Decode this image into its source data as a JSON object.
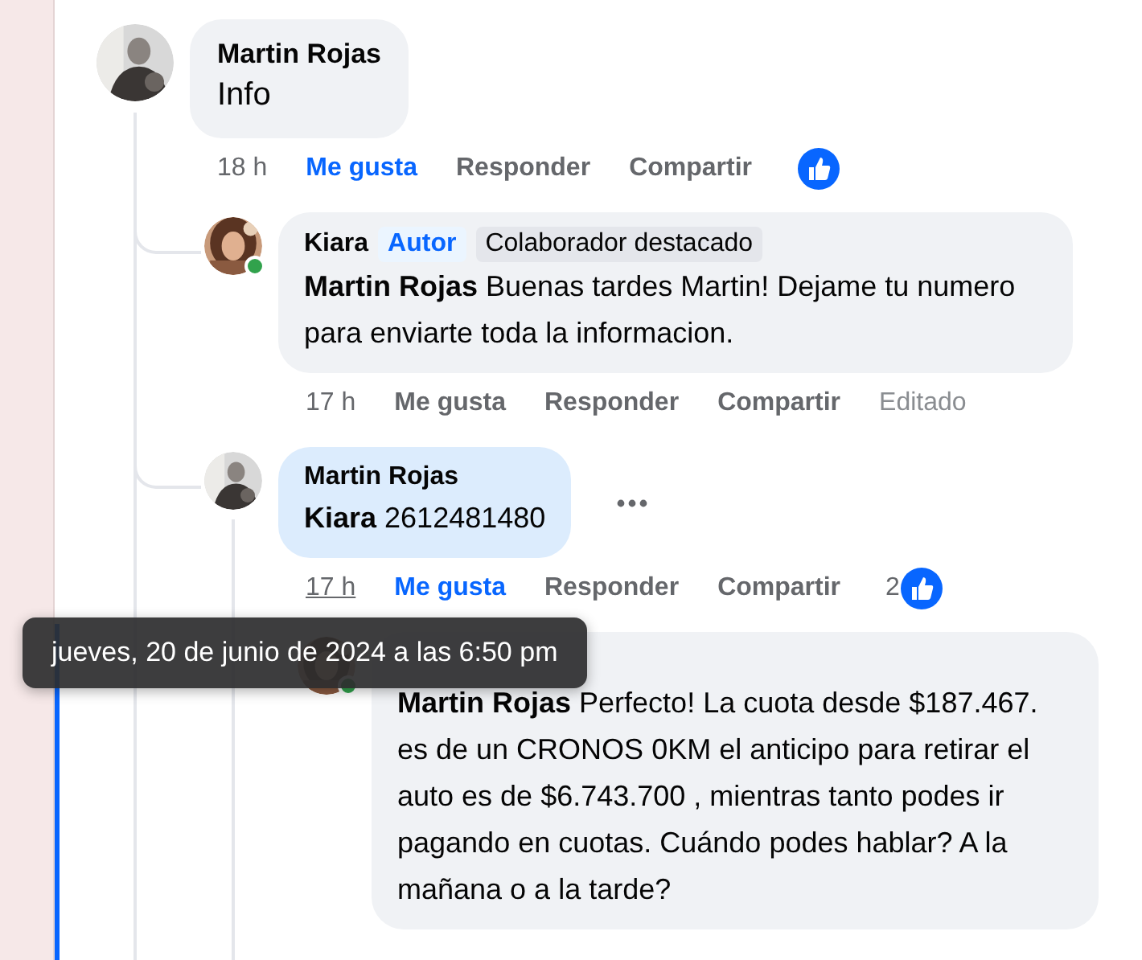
{
  "comments": [
    {
      "author": "Martin Rojas",
      "online": false,
      "text": "Info",
      "time": "18 h",
      "time_hovered": false,
      "like_label": "Me gusta",
      "liked": true,
      "reply_label": "Responder",
      "share_label": "Compartir",
      "reactions": true,
      "children": [
        {
          "author": "Kiara",
          "online": true,
          "badges": [
            {
              "kind": "author",
              "label": "Autor"
            },
            {
              "kind": "top-contributor",
              "label": "Colaborador destacado"
            }
          ],
          "text": "**Martin Rojas** Buenas tardes Martin! Dejame tu numero para enviarte toda la informacion.",
          "time": "17 h",
          "time_hovered": false,
          "like_label": "Me gusta",
          "liked": false,
          "reply_label": "Responder",
          "share_label": "Compartir",
          "edited_label": "Editado"
        },
        {
          "author": "Martin Rojas",
          "online": false,
          "highlighted": true,
          "text": "**Kiara** 2612481480",
          "time": "17 h",
          "time_hovered": true,
          "like_label": "Me gusta",
          "liked": true,
          "reply_label": "Responder",
          "share_label": "Compartir",
          "reactions": true,
          "reaction_count": "2",
          "more_menu": true,
          "children": [
            {
              "online": true,
              "text": "**Martin Rojas** Perfecto! La cuota desde $187.467. es de un CRONOS 0KM el anticipo para retirar el auto es de $6.743.700 , mientras tanto podes ir pagando en cuotas. Cuándo podes hablar? A la mañana o a la tarde?"
            }
          ]
        }
      ]
    }
  ],
  "tooltip": {
    "text": "jueves, 20 de junio de 2024 a las 6:50 pm"
  }
}
